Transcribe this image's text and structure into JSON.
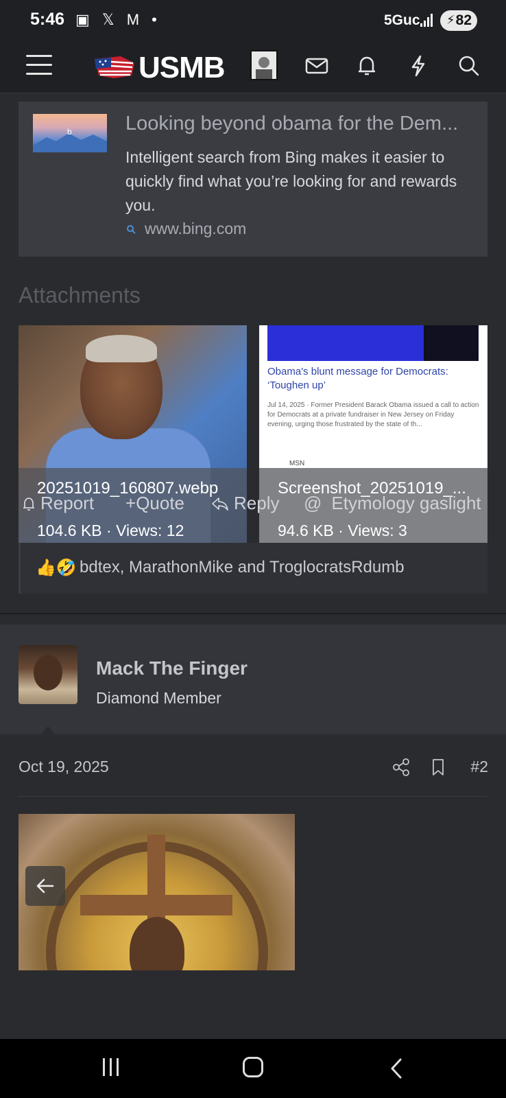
{
  "status_bar": {
    "time": "5:46",
    "network": "5Guc",
    "battery": "82"
  },
  "header": {
    "logo_text": "USMB"
  },
  "ad": {
    "title": "Looking beyond obama for the Dem...",
    "body": "Intelligent search from Bing makes it easier to quickly find what you’re looking for and rewards you.",
    "url": "www.bing.com"
  },
  "attachments": {
    "heading": "Attachments",
    "items": [
      {
        "name": "20251019_160807.webp",
        "meta": "104.6 KB · Views: 12"
      },
      {
        "name": "Screenshot_20251019_...",
        "meta": "94.6 KB · Views: 3",
        "preview_headline": "Obama's blunt message for Democrats: ‘Toughen up’",
        "preview_text": "Jul 14, 2025 · Former President Barack Obama issued a call to action for Democrats at a private fundraiser in New Jersey on Friday evening, urging those frustrated by the state of th...",
        "preview_source": "MSN"
      }
    ]
  },
  "actions": {
    "report": "Report",
    "quote": "Quote",
    "reply": "Reply",
    "mention": "Etymology gaslight"
  },
  "reactions": {
    "emojis": "👍🤣",
    "text": "bdtex, MarathonMike and TroglocratsRdumb"
  },
  "post": {
    "username": "Mack The Finger",
    "user_title": "Diamond Member",
    "date": "Oct 19, 2025",
    "number": "#2"
  },
  "colors": {
    "background": "#2a2b2f",
    "header": "#1f2023",
    "card": "#3b3c41"
  }
}
